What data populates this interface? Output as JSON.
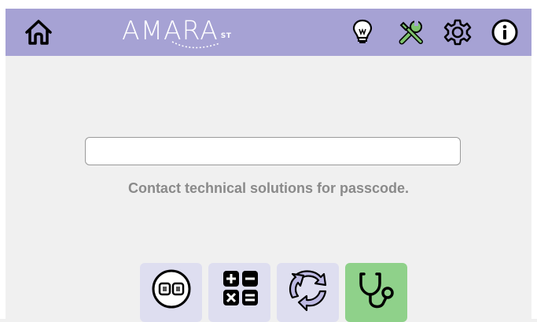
{
  "app": {
    "brand_name": "AMARA",
    "brand_sub": "ST"
  },
  "icons": {
    "home": "home-icon",
    "tips": "lightbulb-icon",
    "tools": "tools-icon",
    "settings": "gear-icon",
    "info": "info-icon",
    "keypad": "keypad-icon",
    "calculator": "calculator-icon",
    "cycle": "cycle-arrows-icon",
    "diagnostics": "stethoscope-icon"
  },
  "passcode": {
    "value": "",
    "hint": "Contact technical solutions for passcode."
  },
  "colors": {
    "header": "#a6a2d4",
    "tile_default": "#dedef0",
    "tile_active": "#8fd18a",
    "background": "#f0f0f0"
  }
}
